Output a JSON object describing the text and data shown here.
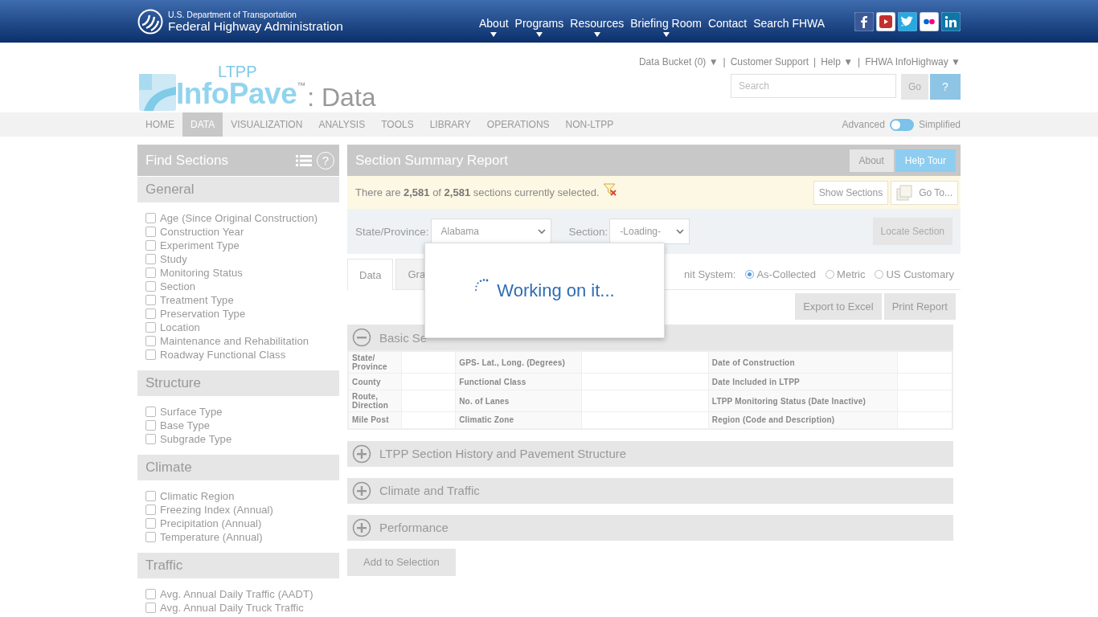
{
  "agency": {
    "line1": "U.S. Department of Transportation",
    "line2": "Federal Highway Administration"
  },
  "top_nav": [
    {
      "label": "About",
      "has_menu": true
    },
    {
      "label": "Programs",
      "has_menu": true
    },
    {
      "label": "Resources",
      "has_menu": true
    },
    {
      "label": "Briefing Room",
      "has_menu": true
    },
    {
      "label": "Contact",
      "has_menu": false
    },
    {
      "label": "Search FHWA",
      "has_menu": false
    }
  ],
  "logo": {
    "small": "LTPP",
    "main": "InfoPave",
    "mark": "™",
    "suffix": ": Data"
  },
  "utility_links": [
    "Data Bucket (0) ▼",
    "Customer Support",
    "Help ▼",
    "FHWA InfoHighway ▼"
  ],
  "utility_separator": "|",
  "search": {
    "placeholder": "Search",
    "go": "Go",
    "help": "?"
  },
  "main_nav": [
    {
      "label": "HOME",
      "selected": false
    },
    {
      "label": "DATA",
      "selected": true
    },
    {
      "label": "VISUALIZATION",
      "selected": false
    },
    {
      "label": "ANALYSIS",
      "selected": false
    },
    {
      "label": "TOOLS",
      "selected": false
    },
    {
      "label": "LIBRARY",
      "selected": false
    },
    {
      "label": "OPERATIONS",
      "selected": false
    },
    {
      "label": "NON-LTPP",
      "selected": false
    }
  ],
  "mode_toggle": {
    "left": "Advanced",
    "right": "Simplified",
    "simplified": false
  },
  "sidebar": {
    "title": "Find Sections",
    "help": "?",
    "groups": [
      {
        "title": "General",
        "items": [
          {
            "label": "Age (Since Original Construction)",
            "checked": false
          },
          {
            "label": "Construction Year",
            "checked": false
          },
          {
            "label": "Experiment Type",
            "checked": false
          },
          {
            "label": "Study",
            "checked": false
          },
          {
            "label": "Monitoring Status",
            "checked": false
          },
          {
            "label": "Section",
            "checked": false
          },
          {
            "label": "Treatment Type",
            "checked": false
          },
          {
            "label": "Preservation Type",
            "checked": false
          },
          {
            "label": "Location",
            "checked": false
          },
          {
            "label": "Maintenance and Rehabilitation",
            "checked": false
          },
          {
            "label": "Roadway Functional Class",
            "checked": false
          }
        ]
      },
      {
        "title": "Structure",
        "items": [
          {
            "label": "Surface Type",
            "checked": false
          },
          {
            "label": "Base Type",
            "checked": false
          },
          {
            "label": "Subgrade Type",
            "checked": false
          }
        ]
      },
      {
        "title": "Climate",
        "items": [
          {
            "label": "Climatic Region",
            "checked": false
          },
          {
            "label": "Freezing Index (Annual)",
            "checked": false
          },
          {
            "label": "Precipitation (Annual)",
            "checked": false
          },
          {
            "label": "Temperature (Annual)",
            "checked": false
          }
        ]
      },
      {
        "title": "Traffic",
        "items": [
          {
            "label": "Avg. Annual Daily Traffic (AADT)",
            "checked": false
          },
          {
            "label": "Avg. Annual Daily Truck Traffic",
            "checked": false
          }
        ]
      }
    ]
  },
  "report": {
    "title": "Section Summary Report",
    "header_buttons": [
      {
        "label": "About",
        "kind": "plain"
      },
      {
        "label": "Help Tour",
        "kind": "primary"
      }
    ],
    "notice": "There are **2,581** of **2,581** sections currently selected.",
    "show_sections": "Show Sections",
    "go_to": "Go To...",
    "state_label": "State/Province:",
    "state_value": "Alabama",
    "section_label": "Section:",
    "section_value": "-Loading-",
    "locate": "Locate Section",
    "tabs": [
      {
        "label": "Data",
        "selected": true
      },
      {
        "label": "Gra",
        "selected": false
      }
    ],
    "unit_label": "nit System:",
    "units": [
      {
        "label": "As-Collected",
        "selected": true
      },
      {
        "label": "Metric",
        "selected": false
      },
      {
        "label": "US Customary",
        "selected": false
      }
    ],
    "actions": [
      "Export to Excel",
      "Print Report"
    ],
    "sections": [
      {
        "title": "Basic Se",
        "expanded": true,
        "rows": [
          [
            "State/ Province",
            "GPS- Lat., Long. (Degrees)",
            "Date of Construction"
          ],
          [
            "County",
            "Functional Class",
            "Date Included in LTPP"
          ],
          [
            "Route, Direction",
            "No. of Lanes",
            "LTPP Monitoring Status (Date Inactive)"
          ],
          [
            "Mile Post",
            "Climatic Zone",
            "Region (Code and Description)"
          ]
        ]
      },
      {
        "title": "LTPP Section History and Pavement Structure",
        "expanded": false
      },
      {
        "title": "Climate and Traffic",
        "expanded": false
      },
      {
        "title": "Performance",
        "expanded": false
      }
    ],
    "add_button": "Add to Selection"
  },
  "loading": {
    "message": "Working on it..."
  }
}
